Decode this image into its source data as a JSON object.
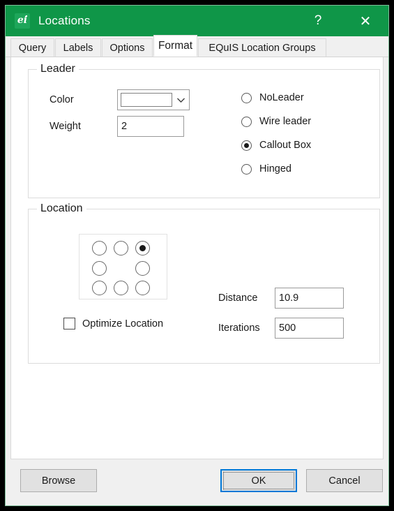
{
  "window": {
    "title": "Locations",
    "icon": "equis-app-icon",
    "help_label": "?",
    "close_label": "✕"
  },
  "tabs": [
    {
      "label": "Query",
      "active": false
    },
    {
      "label": "Labels",
      "active": false
    },
    {
      "label": "Options",
      "active": false
    },
    {
      "label": "Format",
      "active": true
    },
    {
      "label": "EQuIS Location Groups",
      "active": false
    }
  ],
  "leader_group": {
    "title": "Leader",
    "color_label": "Color",
    "color_value": "#000000",
    "color_chevron": "chevron-down-icon",
    "weight_label": "Weight",
    "weight_value": "2",
    "leader_style_options": [
      {
        "label": "NoLeader",
        "selected": false
      },
      {
        "label": "Wire leader",
        "selected": false
      },
      {
        "label": "Callout Box",
        "selected": true
      },
      {
        "label": "Hinged",
        "selected": false
      }
    ]
  },
  "location_group": {
    "title": "Location",
    "anchor_grid": [
      {
        "pos": "top-left",
        "selected": false
      },
      {
        "pos": "top-center",
        "selected": false
      },
      {
        "pos": "top-right",
        "selected": true
      },
      {
        "pos": "middle-left",
        "selected": false
      },
      {
        "pos": "middle-right",
        "selected": false
      },
      {
        "pos": "bottom-left",
        "selected": false
      },
      {
        "pos": "bottom-center",
        "selected": false
      },
      {
        "pos": "bottom-right",
        "selected": false
      }
    ],
    "optimize_label": "Optimize Location",
    "optimize_checked": false,
    "distance_label": "Distance",
    "distance_value": "10.9",
    "iterations_label": "Iterations",
    "iterations_value": "500"
  },
  "footer": {
    "browse_label": "Browse",
    "ok_label": "OK",
    "cancel_label": "Cancel"
  },
  "colors": {
    "titlebar": "#0f9648",
    "accent_focus": "#0078d7",
    "dialog_bg": "#f0f0f0"
  }
}
